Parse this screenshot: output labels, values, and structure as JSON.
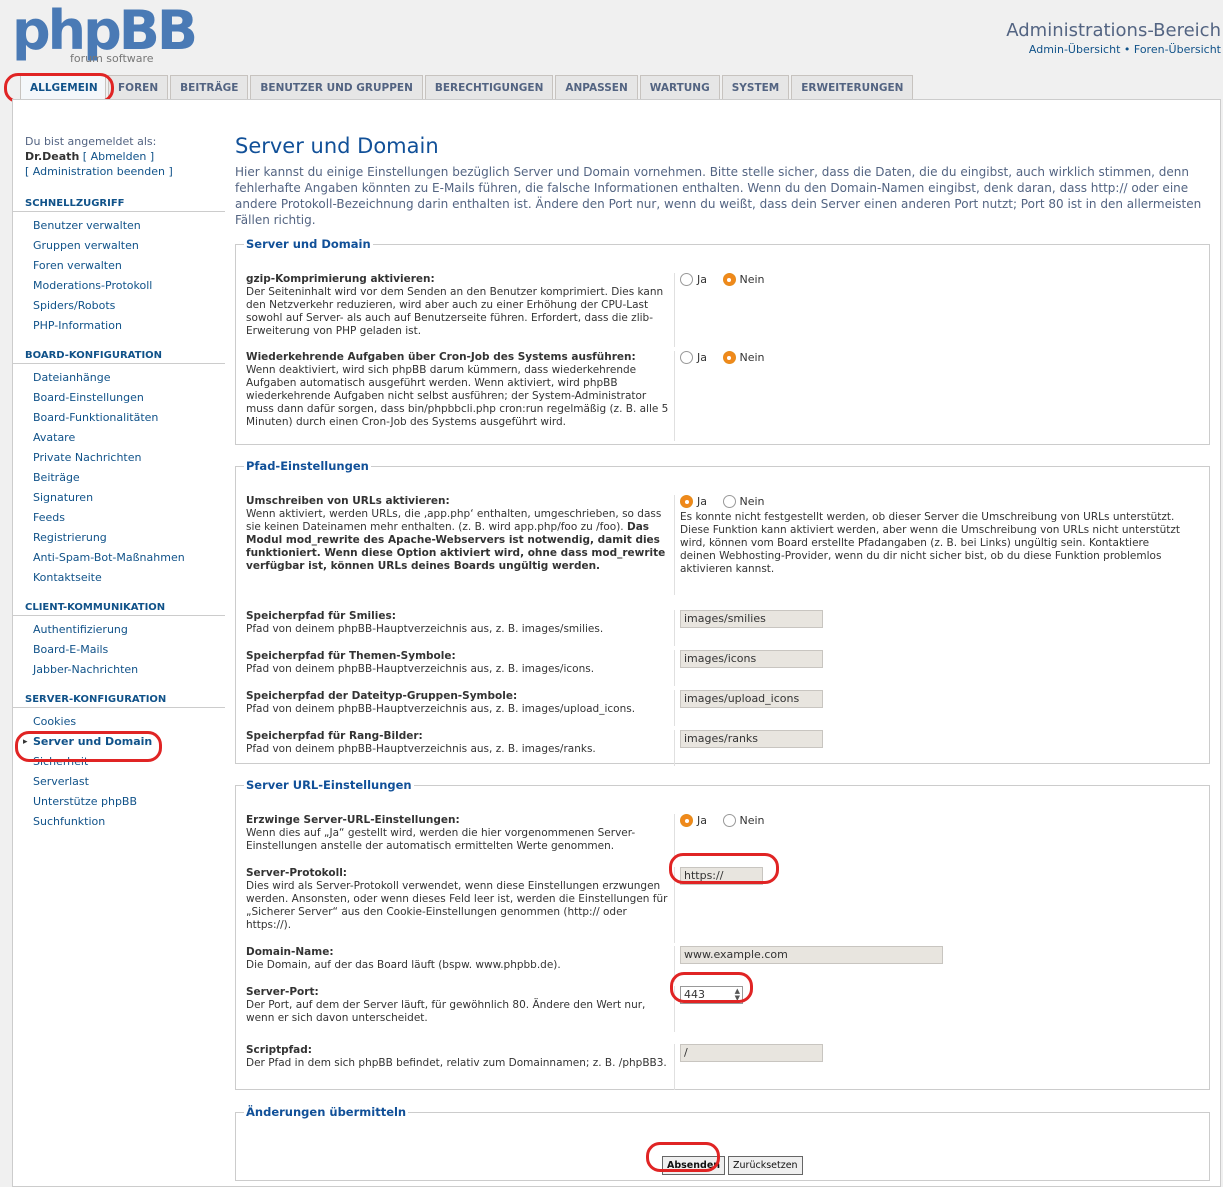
{
  "header": {
    "logo_main": "phpBB",
    "logo_sub": "forum software",
    "admin_title": "Administrations-Bereich",
    "link_overview": "Admin-Übersicht",
    "link_separator": "•",
    "link_forum": "Foren-Übersicht"
  },
  "tabs": [
    "ALLGEMEIN",
    "FOREN",
    "BEITRÄGE",
    "BENUTZER UND GRUPPEN",
    "BERECHTIGUNGEN",
    "ANPASSEN",
    "WARTUNG",
    "SYSTEM",
    "ERWEITERUNGEN"
  ],
  "login": {
    "prefix": "Du bist angemeldet als:",
    "user": "Dr.Death",
    "logout": "[ Abmelden ]",
    "end_admin": "[ Administration beenden ]"
  },
  "menu": [
    {
      "heading": "SCHNELLZUGRIFF",
      "items": [
        "Benutzer verwalten",
        "Gruppen verwalten",
        "Foren verwalten",
        "Moderations-Protokoll",
        "Spiders/Robots",
        "PHP-Information"
      ]
    },
    {
      "heading": "BOARD-KONFIGURATION",
      "items": [
        "Dateianhänge",
        "Board-Einstellungen",
        "Board-Funktionalitäten",
        "Avatare",
        "Private Nachrichten",
        "Beiträge",
        "Signaturen",
        "Feeds",
        "Registrierung",
        "Anti-Spam-Bot-Maßnahmen",
        "Kontaktseite"
      ]
    },
    {
      "heading": "CLIENT-KOMMUNIKATION",
      "items": [
        "Authentifizierung",
        "Board-E-Mails",
        "Jabber-Nachrichten"
      ]
    },
    {
      "heading": "SERVER-KONFIGURATION",
      "items": [
        "Cookies",
        "Server und Domain",
        "Sicherheit",
        "Serverlast",
        "Unterstütze phpBB",
        "Suchfunktion"
      ]
    }
  ],
  "page": {
    "title": "Server und Domain",
    "description": "Hier kannst du einige Einstellungen bezüglich Server und Domain vornehmen. Bitte stelle sicher, dass die Daten, die du eingibst, auch wirklich stimmen, denn fehlerhafte Angaben könnten zu E-Mails führen, die falsche Informationen enthalten. Wenn du den Domain-Namen eingibst, denk daran, dass http:// oder eine andere Protokoll-Bezeichnung darin enthalten ist. Ändere den Port nur, wenn du weißt, dass dein Server einen anderen Port nutzt; Port 80 ist in den allermeisten Fällen richtig."
  },
  "radio": {
    "yes": "Ja",
    "no": "Nein"
  },
  "fs1": {
    "legend": "Server und Domain",
    "gzip_title": "gzip-Komprimierung aktivieren:",
    "gzip_desc": "Der Seiteninhalt wird vor dem Senden an den Benutzer komprimiert. Dies kann den Netzverkehr reduzieren, wird aber auch zu einer Erhöhung der CPU-Last sowohl auf Server- als auch auf Benutzerseite führen. Erfordert, dass die zlib-Erweiterung von PHP geladen ist.",
    "gzip_value": "Nein",
    "cron_title": "Wiederkehrende Aufgaben über Cron-Job des Systems ausführen:",
    "cron_desc": "Wenn deaktiviert, wird sich phpBB darum kümmern, dass wiederkehrende Aufgaben automatisch ausgeführt werden. Wenn aktiviert, wird phpBB wiederkehrende Aufgaben nicht selbst ausführen; der System-Administrator muss dann dafür sorgen, dass bin/phpbbcli.php cron:run regelmäßig (z. B. alle 5 Minuten) durch einen Cron-Job des Systems ausgeführt wird.",
    "cron_value": "Nein"
  },
  "fs2": {
    "legend": "Pfad-Einstellungen",
    "rewrite_title": "Umschreiben von URLs aktivieren:",
    "rewrite_desc": "Wenn aktiviert, werden URLs, die ‚app.php‘ enthalten, umgeschrieben, so dass sie keinen Dateinamen mehr enthalten. (z. B. wird app.php/foo zu /foo).",
    "rewrite_bold": "Das Modul mod_rewrite des Apache-Webservers ist notwendig, damit dies funktioniert. Wenn diese Option aktiviert wird, ohne dass mod_rewrite verfügbar ist, können URLs deines Boards ungültig werden.",
    "rewrite_value": "Ja",
    "rewrite_hint": "Es konnte nicht festgestellt werden, ob dieser Server die Umschreibung von URLs unterstützt. Diese Funktion kann aktiviert werden, aber wenn die Umschreibung von URLs nicht unterstützt wird, können vom Board erstellte Pfadangaben (z. B. bei Links) ungültig sein. Kontaktiere deinen Webhosting-Provider, wenn du dir nicht sicher bist, ob du diese Funktion problemlos aktivieren kannst.",
    "smilies_title": "Speicherpfad für Smilies:",
    "smilies_desc": "Pfad von deinem phpBB-Hauptverzeichnis aus, z. B. images/smilies.",
    "smilies_value": "images/smilies",
    "icons_title": "Speicherpfad für Themen-Symbole:",
    "icons_desc": "Pfad von deinem phpBB-Hauptverzeichnis aus, z. B. images/icons.",
    "icons_value": "images/icons",
    "upload_title": "Speicherpfad der Dateityp-Gruppen-Symbole:",
    "upload_desc": "Pfad von deinem phpBB-Hauptverzeichnis aus, z. B. images/upload_icons.",
    "upload_value": "images/upload_icons",
    "ranks_title": "Speicherpfad für Rang-Bilder:",
    "ranks_desc": "Pfad von deinem phpBB-Hauptverzeichnis aus, z. B. images/ranks.",
    "ranks_value": "images/ranks"
  },
  "fs3": {
    "legend": "Server URL-Einstellungen",
    "force_title": "Erzwinge Server-URL-Einstellungen:",
    "force_desc": "Wenn dies auf „Ja“ gestellt wird, werden die hier vorgenommenen Server-Einstellungen anstelle der automatisch ermittelten Werte genommen.",
    "force_value": "Ja",
    "proto_title": "Server-Protokoll:",
    "proto_desc": "Dies wird als Server-Protokoll verwendet, wenn diese Einstellungen erzwungen werden. Ansonsten, oder wenn dieses Feld leer ist, werden die Einstellungen für „Sicherer Server“ aus den Cookie-Einstellungen genommen (http:// oder https://).",
    "proto_value": "https://",
    "domain_title": "Domain-Name:",
    "domain_desc": "Die Domain, auf der das Board läuft (bspw. www.phpbb.de).",
    "domain_value": "www.example.com",
    "port_title": "Server-Port:",
    "port_desc": "Der Port, auf dem der Server läuft, für gewöhnlich 80. Ändere den Wert nur, wenn er sich davon unterscheidet.",
    "port_value": "443",
    "script_title": "Scriptpfad:",
    "script_desc": "Der Pfad in dem sich phpBB befindet, relativ zum Domainnamen; z. B. /phpBB3.",
    "script_value": "/"
  },
  "fs4": {
    "legend": "Änderungen übermitteln",
    "submit": "Absenden",
    "reset": "Zurücksetzen"
  },
  "colors": {
    "link": "#105289",
    "title": "#115098",
    "highlight": "#e02424",
    "radio_on": "#f0891b"
  }
}
